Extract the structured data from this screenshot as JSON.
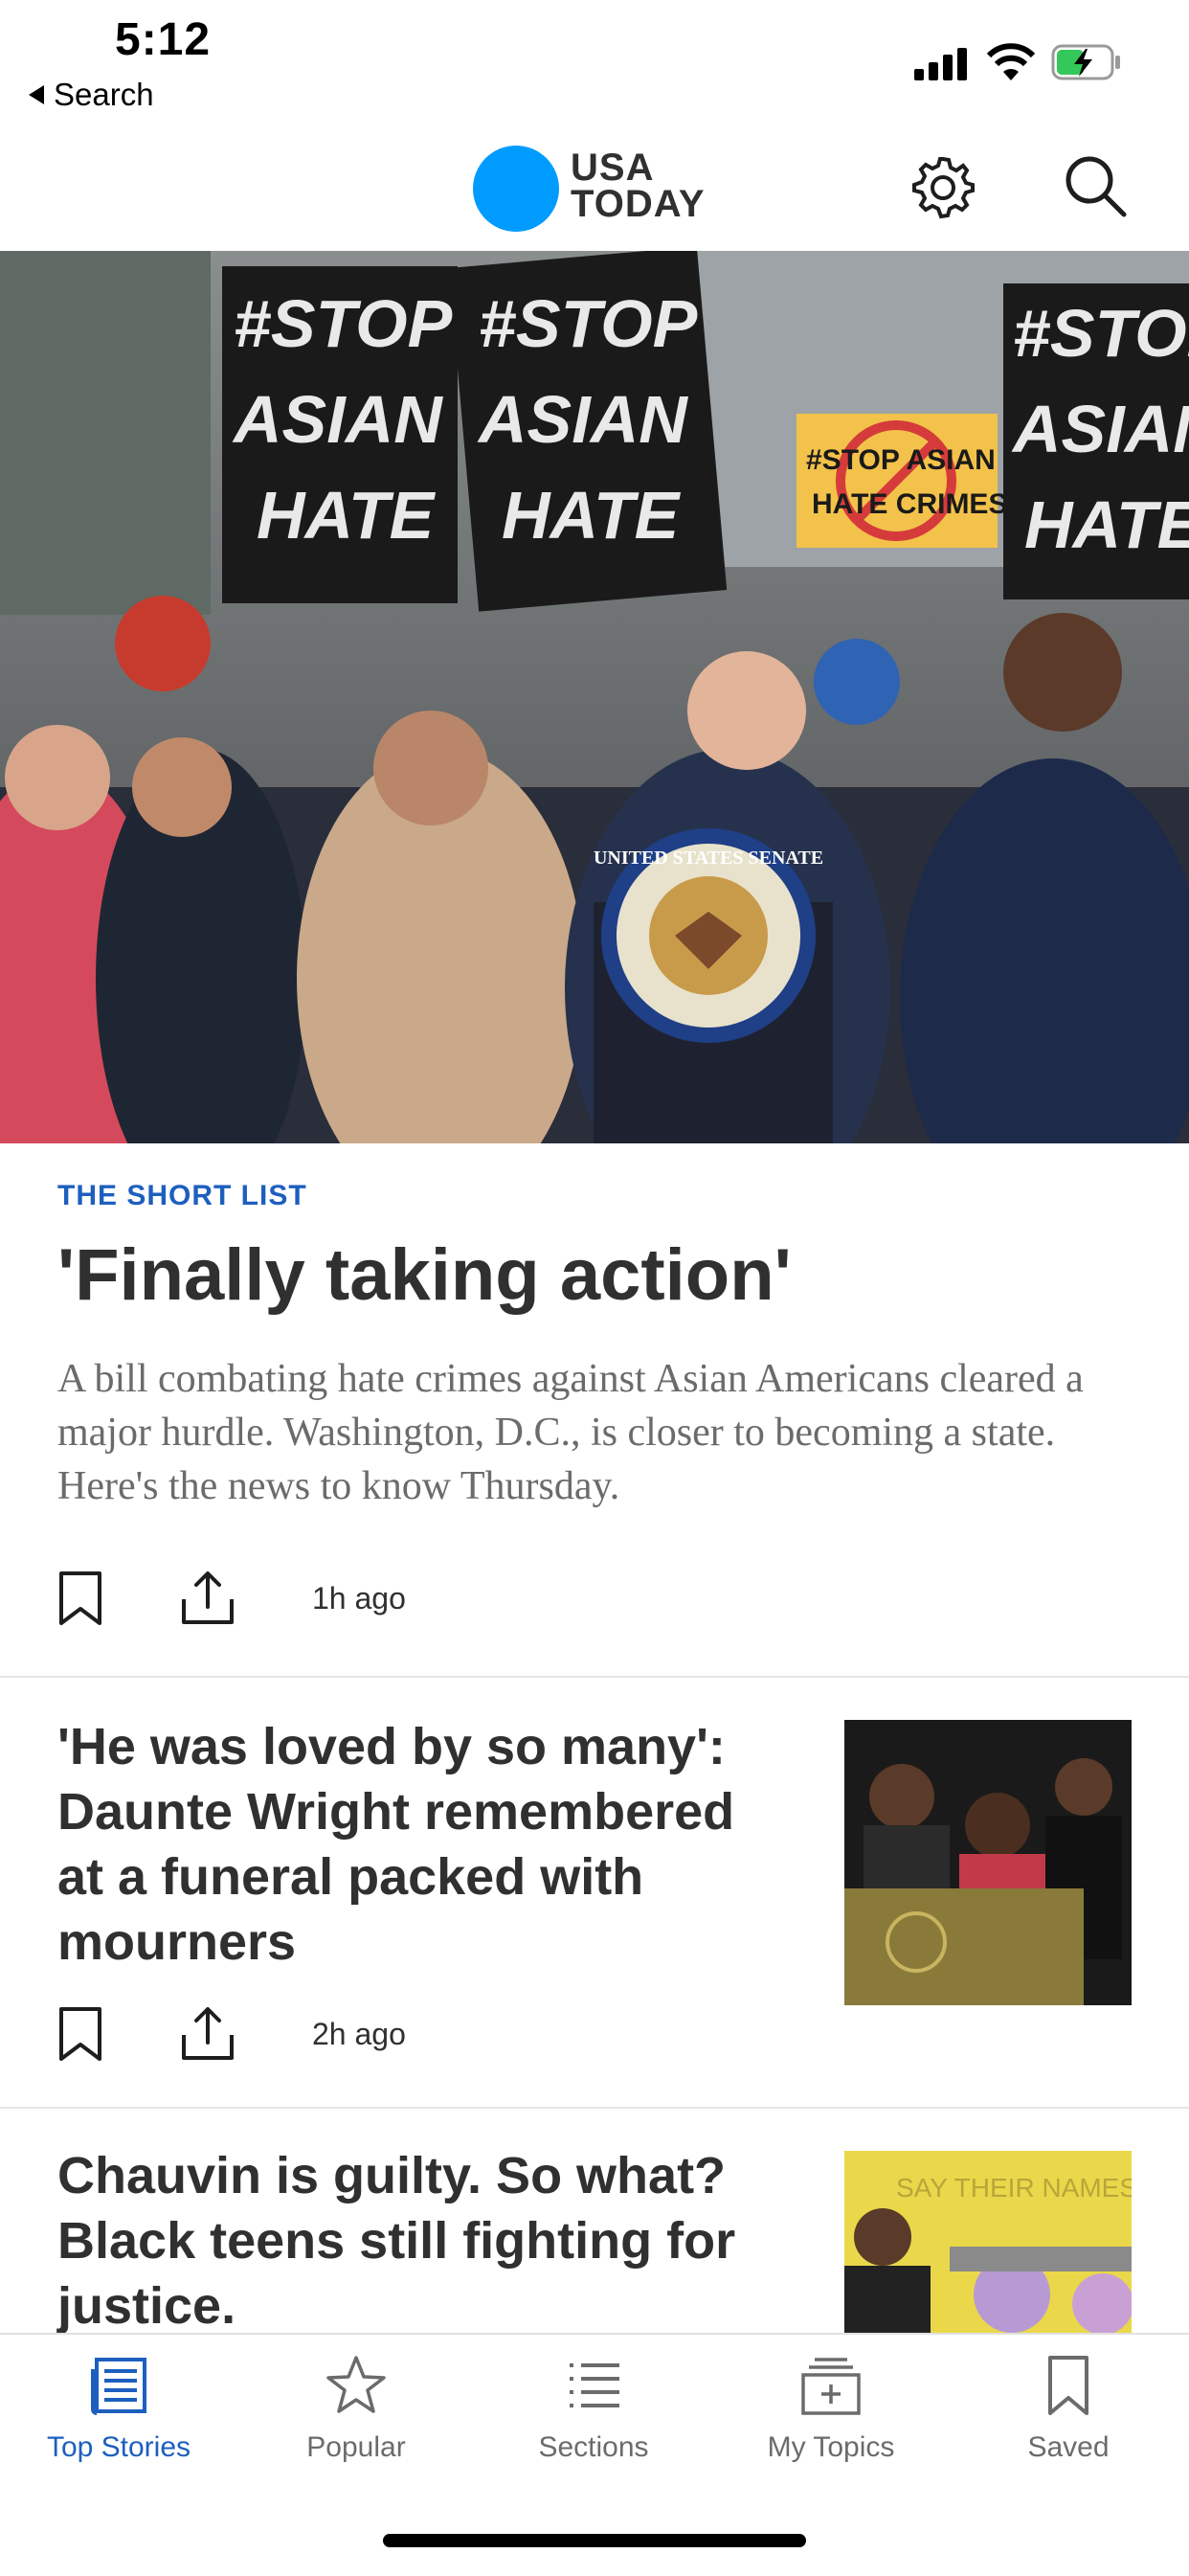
{
  "status": {
    "time": "5:12",
    "back_label": "Search"
  },
  "header": {
    "logo_line1": "USA",
    "logo_line2": "TODAY",
    "brand_color": "#009bff"
  },
  "hero": {
    "signs": [
      "#STOP",
      "ASIAN",
      "HATE"
    ],
    "sign_small": [
      "#STOP ASIAN",
      "HATE CRIMES"
    ],
    "seal_text": "UNITED STATES SENATE"
  },
  "lead_story": {
    "kicker": "THE SHORT LIST",
    "headline": "'Finally taking action'",
    "summary": "A bill combating hate crimes against Asian Americans cleared a major hurdle. Washington, D.C., is closer to becoming a state. Here's the news to know Thursday.",
    "time_ago": "1h ago"
  },
  "stories": [
    {
      "headline": "'He was loved by so many': Daunte Wright remembered at a funeral packed with mourners",
      "time_ago": "2h ago"
    },
    {
      "headline": "Chauvin is guilty. So what? Black teens still fighting for justice.",
      "thumb_text": "SAY THEIR NAMES"
    }
  ],
  "tabs": [
    {
      "label": "Top Stories",
      "icon": "newspaper-icon",
      "active": true
    },
    {
      "label": "Popular",
      "icon": "star-icon",
      "active": false
    },
    {
      "label": "Sections",
      "icon": "list-icon",
      "active": false
    },
    {
      "label": "My Topics",
      "icon": "add-topic-icon",
      "active": false
    },
    {
      "label": "Saved",
      "icon": "bookmark-icon",
      "active": false
    }
  ],
  "colors": {
    "accent": "#1d5fbf",
    "text": "#303030",
    "muted": "#6b6b6b"
  }
}
